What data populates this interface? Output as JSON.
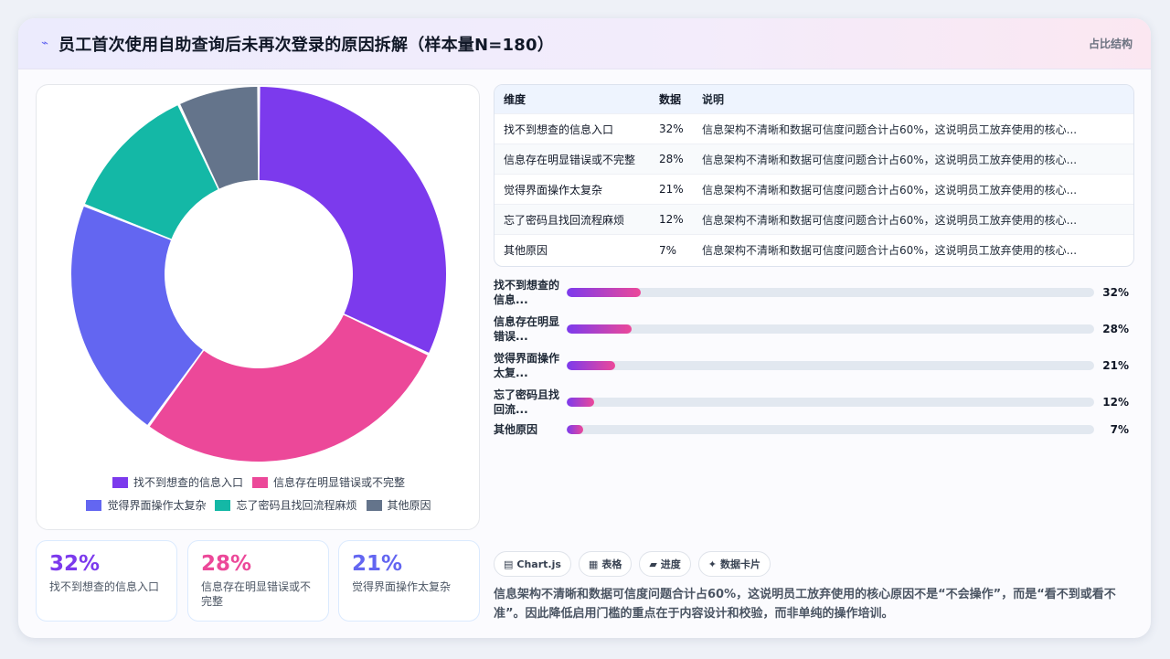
{
  "header": {
    "title": "员工首次使用自助查询后未再次登录的原因拆解（样本量N=180）",
    "title_icon": "sparkle-icon",
    "tag": "占比结构"
  },
  "chart_data": {
    "type": "pie",
    "variant": "doughnut",
    "categories": [
      "找不到想查的信息入口",
      "信息存在明显错误或不完整",
      "觉得界面操作太复杂",
      "忘了密码且找回流程麻烦",
      "其他原因"
    ],
    "values": [
      32,
      28,
      21,
      12,
      7
    ],
    "unit": "%",
    "colors": [
      "#7c3aed",
      "#ec4899",
      "#6366f1",
      "#14b8a6",
      "#64748b"
    ],
    "legend_position": "bottom"
  },
  "stats": [
    {
      "value": "32%",
      "label": "找不到想查的信息入口",
      "color": "#7c3aed"
    },
    {
      "value": "28%",
      "label": "信息存在明显错误或不完整",
      "color": "#ec4899"
    },
    {
      "value": "21%",
      "label": "觉得界面操作太复杂",
      "color": "#6366f1"
    }
  ],
  "table": {
    "headers": [
      "维度",
      "数据",
      "说明"
    ],
    "rows": [
      [
        "找不到想查的信息入口",
        "32%",
        "信息架构不清晰和数据可信度问题合计占60%，这说明员工放弃使用的核心..."
      ],
      [
        "信息存在明显错误或不完整",
        "28%",
        "信息架构不清晰和数据可信度问题合计占60%，这说明员工放弃使用的核心..."
      ],
      [
        "觉得界面操作太复杂",
        "21%",
        "信息架构不清晰和数据可信度问题合计占60%，这说明员工放弃使用的核心..."
      ],
      [
        "忘了密码且找回流程麻烦",
        "12%",
        "信息架构不清晰和数据可信度问题合计占60%，这说明员工放弃使用的核心..."
      ],
      [
        "其他原因",
        "7%",
        "信息架构不清晰和数据可信度问题合计占60%，这说明员工放弃使用的核心..."
      ]
    ]
  },
  "bars": [
    {
      "label": "找不到想查的信息...",
      "value": "32%",
      "pct": 0.32
    },
    {
      "label": "信息存在明显错误...",
      "value": "28%",
      "pct": 0.28
    },
    {
      "label": "觉得界面操作太复...",
      "value": "21%",
      "pct": 0.21
    },
    {
      "label": "忘了密码且找回流...",
      "value": "12%",
      "pct": 0.12
    },
    {
      "label": "其他原因",
      "value": "7%",
      "pct": 0.07
    }
  ],
  "chips": [
    {
      "icon": "chart-icon",
      "glyph": "▤",
      "label": "Chart.js"
    },
    {
      "icon": "table-icon",
      "glyph": "▦",
      "label": "表格"
    },
    {
      "icon": "progress-icon",
      "glyph": "▰",
      "label": "进度"
    },
    {
      "icon": "card-icon",
      "glyph": "✦",
      "label": "数据卡片"
    }
  ],
  "summary": "信息架构不清晰和数据可信度问题合计占60%，这说明员工放弃使用的核心原因不是“不会操作”，而是“看不到或看不准”。因此降低启用门槛的重点在于内容设计和校验，而非单纯的操作培训。"
}
